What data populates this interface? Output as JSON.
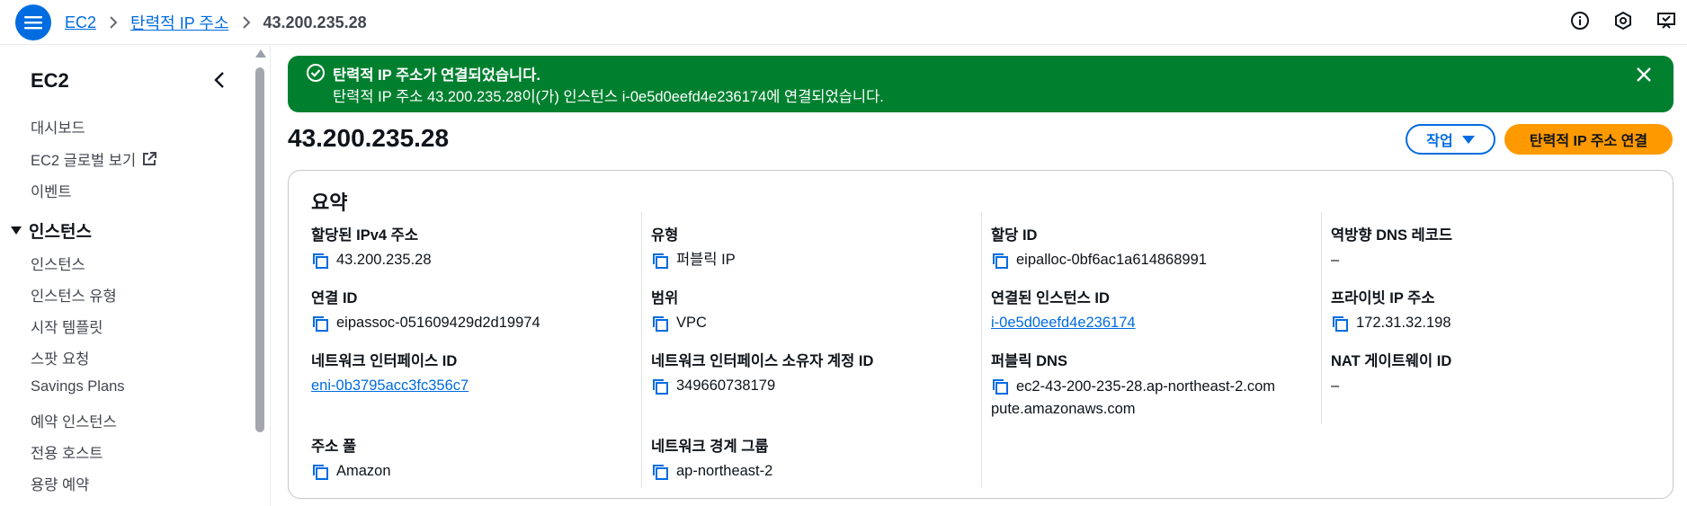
{
  "breadcrumb": {
    "items": [
      "EC2",
      "탄력적 IP 주소"
    ],
    "current": "43.200.235.28"
  },
  "sidebar": {
    "title": "EC2",
    "top_items": [
      {
        "label": "대시보드"
      },
      {
        "label": "EC2 글로벌 보기"
      },
      {
        "label": "이벤트"
      }
    ],
    "section": {
      "label": "인스턴스",
      "items": [
        "인스턴스",
        "인스턴스 유형",
        "시작 템플릿",
        "스팟 요청",
        "Savings Plans",
        "예약 인스턴스",
        "전용 호스트",
        "용량 예약"
      ]
    }
  },
  "flash": {
    "type": "success",
    "title": "탄력적 IP 주소가 연결되었습니다.",
    "body": "탄력적 IP 주소 43.200.235.28이(가) 인스턴스 i-0e5d0eefd4e236174에 연결되었습니다."
  },
  "page": {
    "title": "43.200.235.28",
    "actions_label": "작업",
    "primary_label": "탄력적 IP 주소 연결"
  },
  "summary": {
    "title": "요약",
    "columns": [
      [
        {
          "label": "할당된 IPv4 주소",
          "value": "43.200.235.28",
          "copy": true
        },
        {
          "label": "연결 ID",
          "value": "eipassoc-051609429d2d19974",
          "copy": true
        },
        {
          "label": "네트워크 인터페이스 ID",
          "value": "eni-0b3795acc3fc356c7",
          "link": true
        },
        {
          "label": "주소 풀",
          "value": "Amazon",
          "copy": true
        }
      ],
      [
        {
          "label": "유형",
          "value": "퍼블릭 IP",
          "copy": true
        },
        {
          "label": "범위",
          "value": "VPC",
          "copy": true
        },
        {
          "label": "네트워크 인터페이스 소유자 계정 ID",
          "value": "349660738179",
          "copy": true
        },
        {
          "label": "네트워크 경계 그룹",
          "value": "ap-northeast-2",
          "copy": true
        }
      ],
      [
        {
          "label": "할당 ID",
          "value": "eipalloc-0bf6ac1a614868991",
          "copy": true
        },
        {
          "label": "연결된 인스턴스 ID",
          "value": "i-0e5d0eefd4e236174",
          "link": true
        },
        {
          "label": "퍼블릭 DNS",
          "value_line1": "ec2-43-200-235-28.ap-northeast-2.com",
          "value_line2": "pute.amazonaws.com",
          "copy": true
        }
      ],
      [
        {
          "label": "역방향 DNS 레코드",
          "value": "–"
        },
        {
          "label": "프라이빗 IP 주소",
          "value": "172.31.32.198",
          "copy": true
        },
        {
          "label": "NAT 게이트웨이 ID",
          "value": "–"
        }
      ]
    ]
  },
  "colors": {
    "brand_blue": "#006ce0",
    "success_green": "#00802f",
    "primary_orange": "#ff9900"
  }
}
